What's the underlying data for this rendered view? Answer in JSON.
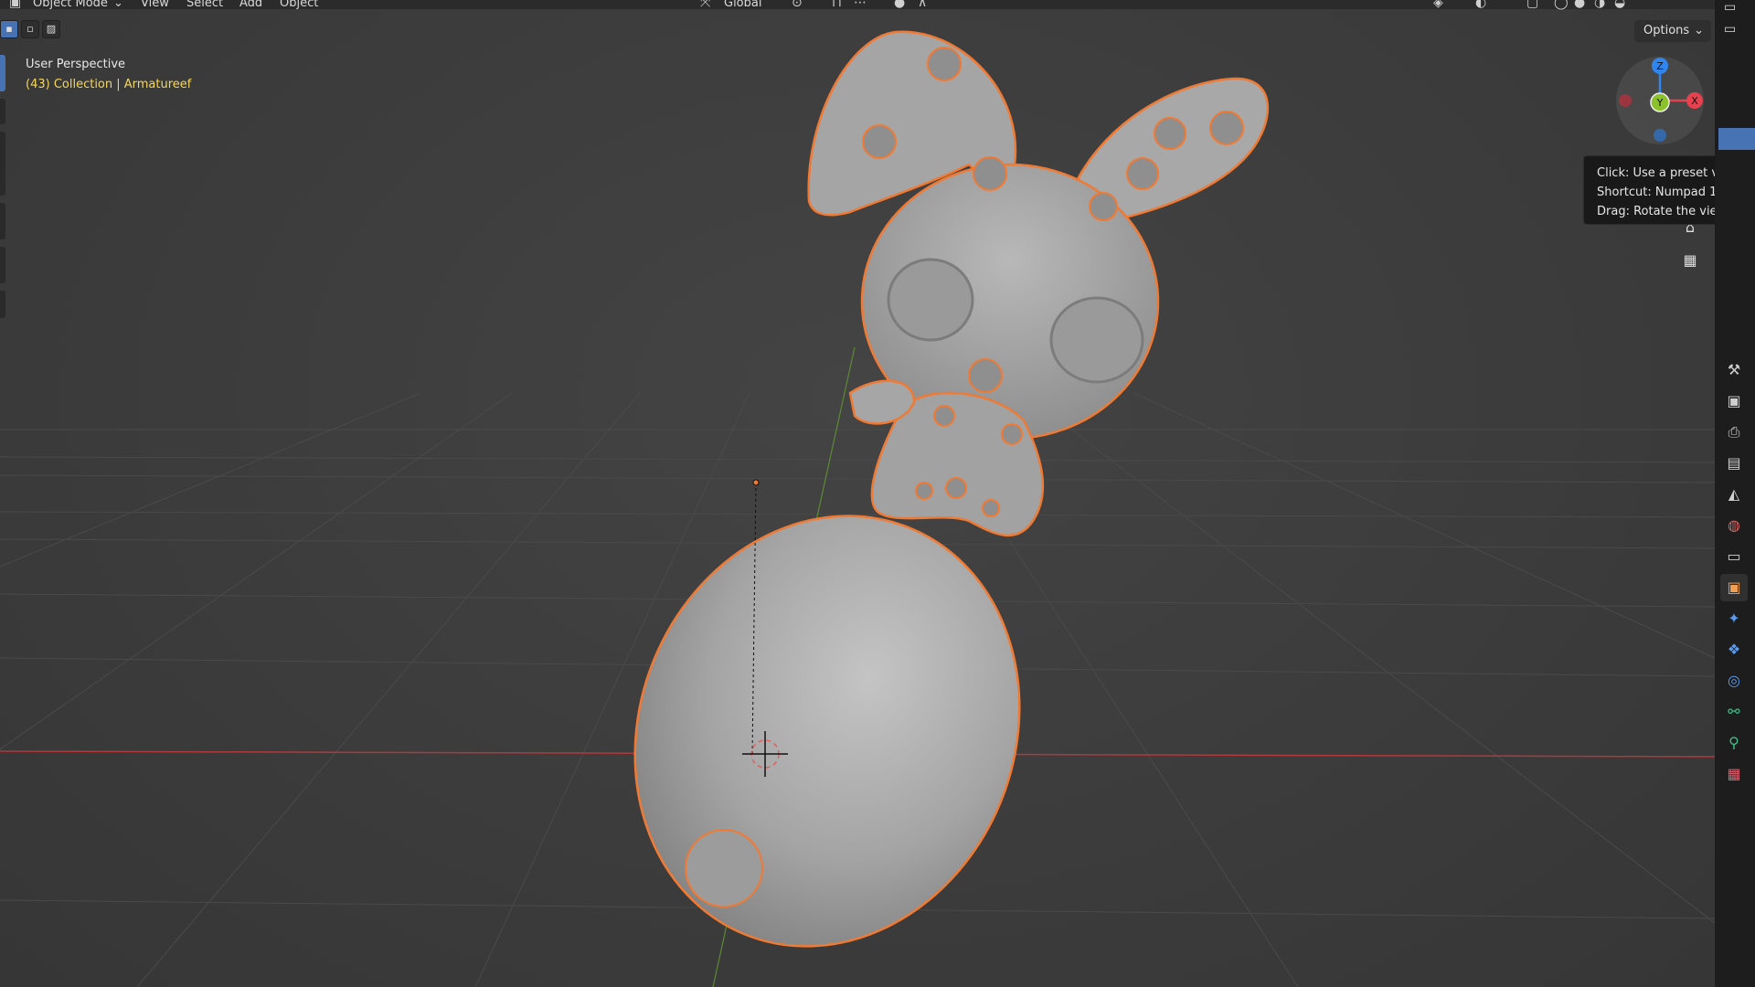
{
  "header": {
    "mode_label": "Object Mode",
    "menus": [
      "View",
      "Select",
      "Add",
      "Object"
    ],
    "transform_orientation": "Global"
  },
  "viewport": {
    "view_name": "User Perspective",
    "collection_line": "(43) Collection | Armatureef",
    "options_label": "Options"
  },
  "gizmo": {
    "z_label": "Z",
    "y_label": "Y",
    "x_label": "X",
    "colors": {
      "x": "#e5414e",
      "y": "#8bc12a",
      "z": "#2f86ee"
    }
  },
  "tooltip": {
    "line1": "Click: Use a preset viewpoint",
    "line2": "Shortcut: Numpad 1",
    "line3": "Drag: Rotate the view"
  },
  "icons": {
    "nav": [
      "camera-icon",
      "grid-ortho-icon"
    ],
    "properties_tabs": [
      "tool-icon",
      "render-icon",
      "output-icon",
      "view-layer-icon",
      "scene-icon",
      "world-icon",
      "collection-icon",
      "object-icon",
      "modifier-icon",
      "particles-icon",
      "physics-icon",
      "constraints-icon",
      "data-icon",
      "texture-icon"
    ]
  },
  "colors": {
    "selection_outline": "#f07a33",
    "active_tab": "#4772b3",
    "collection_text": "#f5d75a"
  }
}
